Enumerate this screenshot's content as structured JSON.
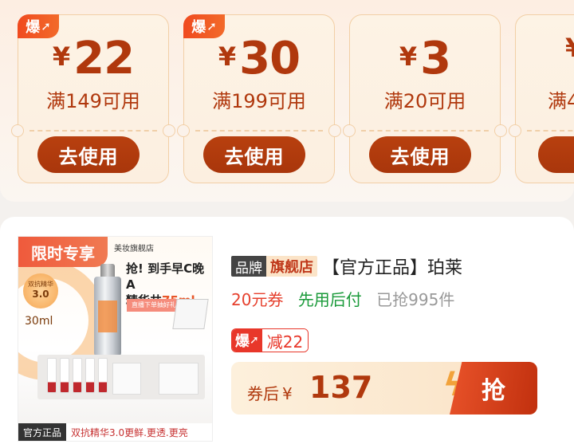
{
  "coupons": [
    {
      "hot": "爆",
      "currency": "¥",
      "amount": "22",
      "condition": "满149可用",
      "button": "去使用"
    },
    {
      "hot": "爆",
      "currency": "¥",
      "amount": "30",
      "condition": "满199可用",
      "button": "去使用"
    },
    {
      "currency": "¥",
      "amount": "3",
      "condition": "满20可用",
      "button": "去使用"
    },
    {
      "currency": "¥",
      "amount": "",
      "condition": "满4",
      "button": "去"
    }
  ],
  "product": {
    "image": {
      "limited_label": "限时专享",
      "store_name": "美妆旗舰店",
      "badge_small": "双抗精华",
      "badge_version": "3.0",
      "volume": "30ml",
      "headline_1": "抢! 到手早C晚A",
      "headline_2": "精华共",
      "headline_amount": "75ml",
      "live_text": "直播下单抽好礼",
      "official_label": "官方正品",
      "slogan": "双抗精华3.0更鲜.更透.更亮"
    },
    "brand_tag": "品牌",
    "flagship_tag": "旗舰店",
    "title": "【官方正品】珀莱",
    "coupon_text": "20元券",
    "bnpl_text": "先用后付",
    "sold_text": "已抢995件",
    "hot_label": "爆",
    "discount_text": "减22",
    "price_label": "券后",
    "currency": "¥",
    "price": "137",
    "buy_button": "抢"
  },
  "colors": {
    "accent": "#b0380d",
    "hot": "#e8372a",
    "green": "#1a9a3a"
  }
}
